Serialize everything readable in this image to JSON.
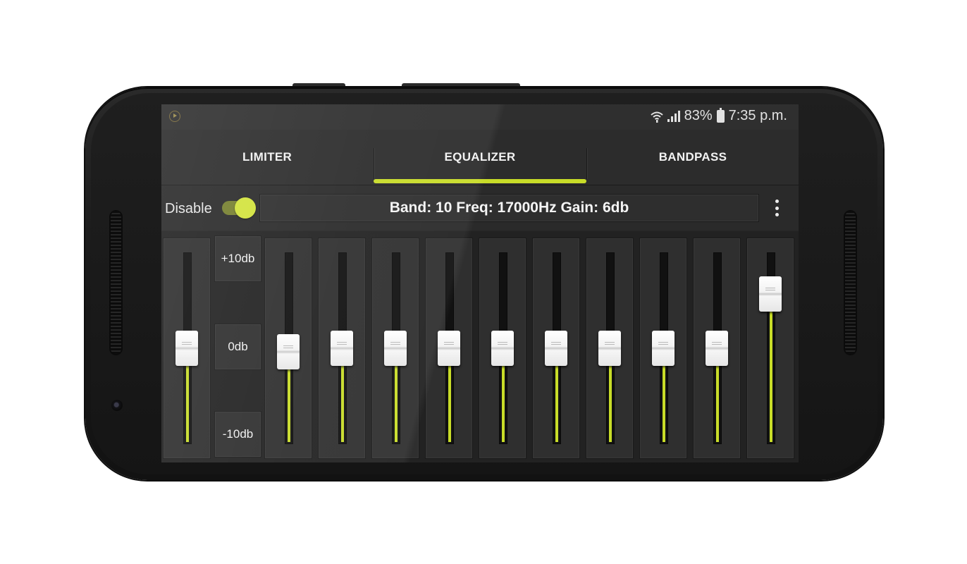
{
  "status_bar": {
    "battery": "83%",
    "time": "7:35 p.m."
  },
  "tabs": [
    {
      "label": "LIMITER",
      "active": false
    },
    {
      "label": "EQUALIZER",
      "active": true
    },
    {
      "label": "BANDPASS",
      "active": false
    }
  ],
  "controls": {
    "disable_label": "Disable",
    "toggle_on": true,
    "band_info": "Band: 10 Freq: 17000Hz Gain: 6db"
  },
  "scale_labels": {
    "top": "+10db",
    "mid": "0db",
    "bottom": "-10db"
  },
  "equalizer": {
    "preamp_level": 0.5,
    "band_levels": [
      0.48,
      0.5,
      0.5,
      0.5,
      0.5,
      0.5,
      0.5,
      0.5,
      0.5,
      0.79
    ],
    "selected_band": 10
  },
  "colors": {
    "accent": "#c8dc28",
    "background": "#262626"
  },
  "icons": [
    "app-notification-icon",
    "wifi-icon",
    "signal-icon",
    "battery-icon",
    "more-vert-icon"
  ]
}
